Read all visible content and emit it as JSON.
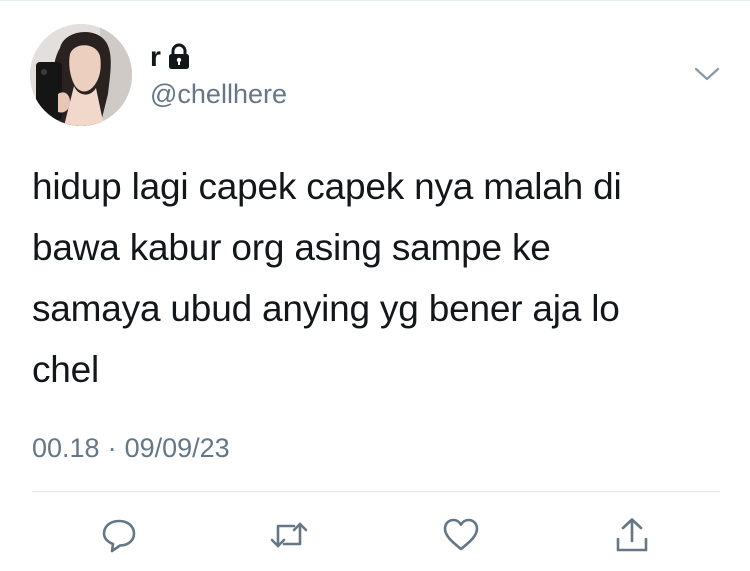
{
  "author": {
    "display_name": "r",
    "handle": "@chellhere",
    "protected_account_icon": "lock-icon",
    "avatar": "avatar-photo"
  },
  "tweet": {
    "text": "hidup lagi capek capek nya malah di\nbawa kabur org asing sampe ke\nsamaya ubud anying yg bener aja lo\nchel",
    "time": "00.18",
    "separator": "·",
    "date": "09/09/23"
  },
  "actions": [
    {
      "name": "reply",
      "icon": "speech-bubble-icon"
    },
    {
      "name": "retweet",
      "icon": "retweet-arrows-icon"
    },
    {
      "name": "like",
      "icon": "heart-icon"
    },
    {
      "name": "share",
      "icon": "share-upload-icon"
    }
  ],
  "menu": {
    "icon": "chevron-down-icon"
  },
  "colors": {
    "text_primary": "#14171a",
    "text_secondary": "#657786",
    "icon": "#657786",
    "divider": "#e1e8ed"
  }
}
